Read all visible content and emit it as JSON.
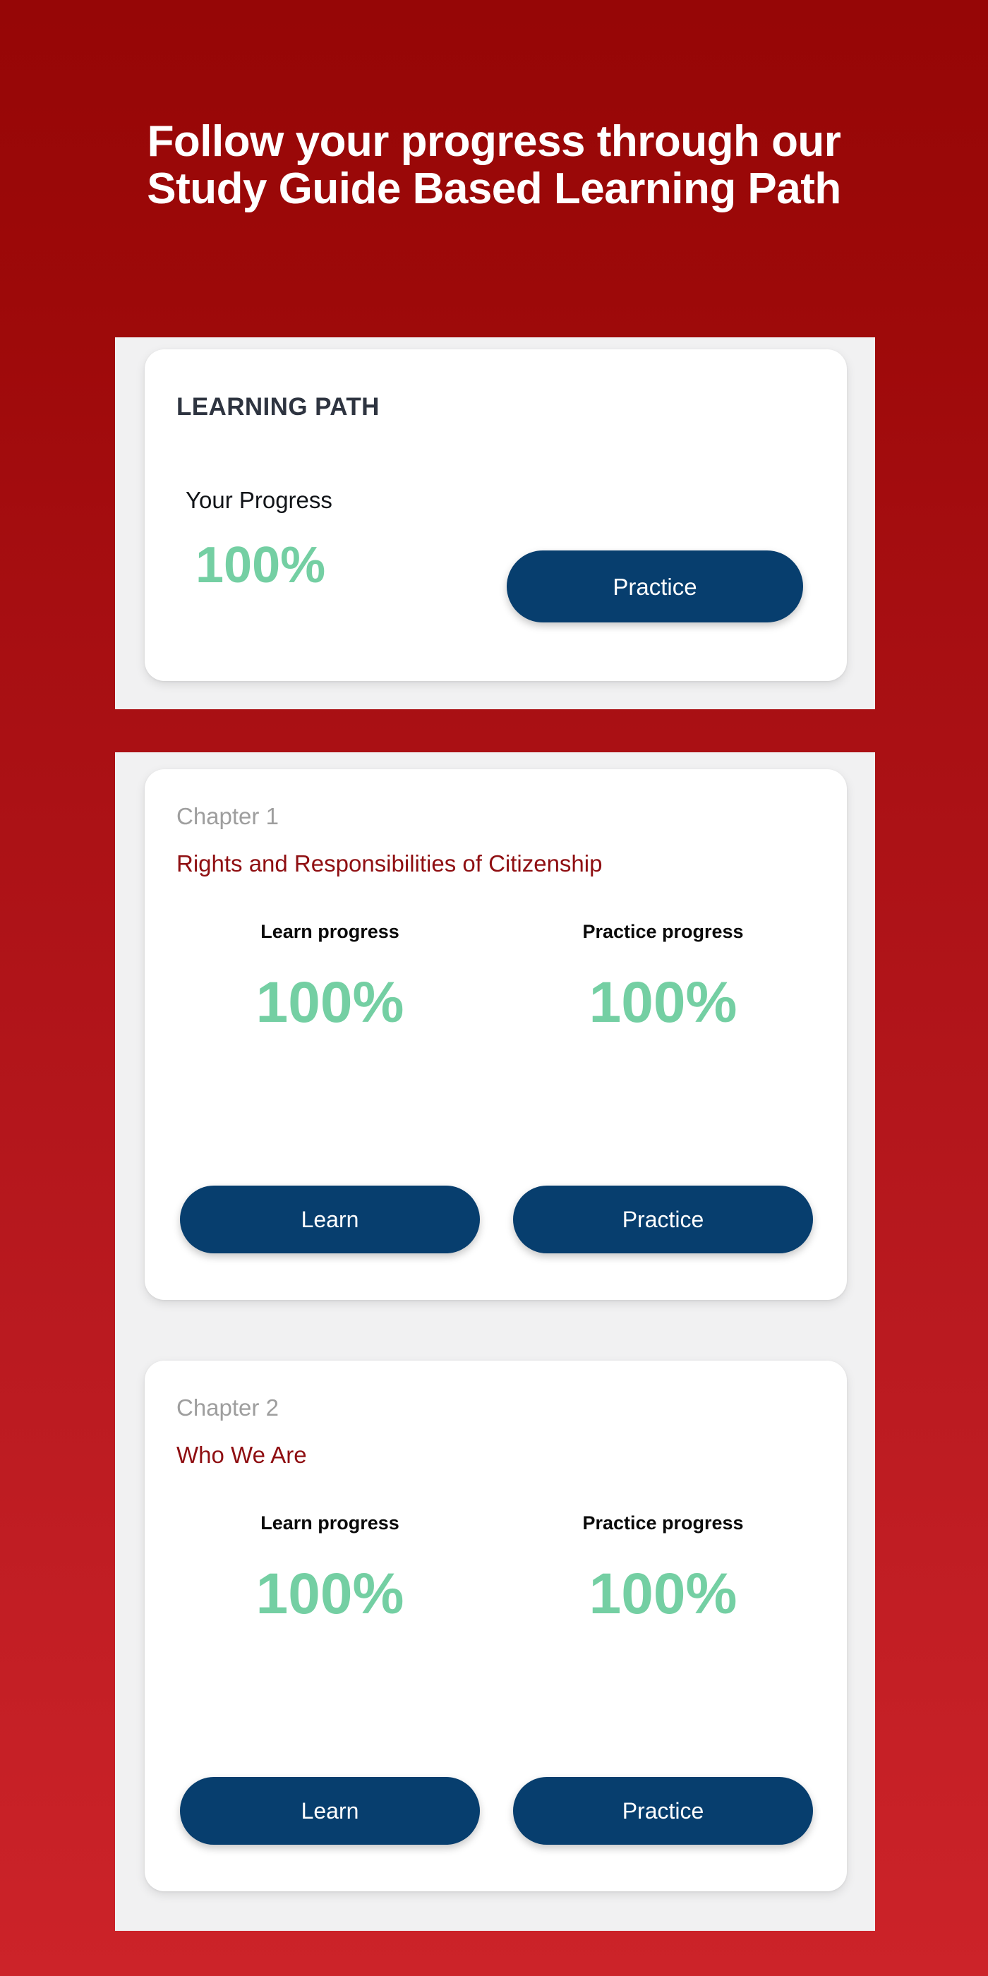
{
  "page": {
    "headline_line1": "Follow your progress through our",
    "headline_line2": "Study Guide Based Learning Path",
    "colors": {
      "background_top": "#960606",
      "background_bottom": "#cc2329",
      "panel": "#f1f1f2",
      "card": "#ffffff",
      "button": "#073e6e",
      "progress_green": "#74cfa3",
      "chapter_title_red": "#8f0f12",
      "chapter_number_gray": "#9e9e9e",
      "heading_slate": "#2e3440"
    }
  },
  "learning_path": {
    "title": "LEARNING PATH",
    "progress_label": "Your Progress",
    "progress_value": "100%",
    "practice_button": "Practice"
  },
  "chapters": [
    {
      "number": "Chapter 1",
      "title": "Rights and Responsibilities of Citizenship",
      "learn_label": "Learn progress",
      "practice_label": "Practice progress",
      "learn_value": "100%",
      "practice_value": "100%",
      "learn_button": "Learn",
      "practice_button": "Practice"
    },
    {
      "number": "Chapter 2",
      "title": "Who We Are",
      "learn_label": "Learn progress",
      "practice_label": "Practice progress",
      "learn_value": "100%",
      "practice_value": "100%",
      "learn_button": "Learn",
      "practice_button": "Practice"
    }
  ]
}
